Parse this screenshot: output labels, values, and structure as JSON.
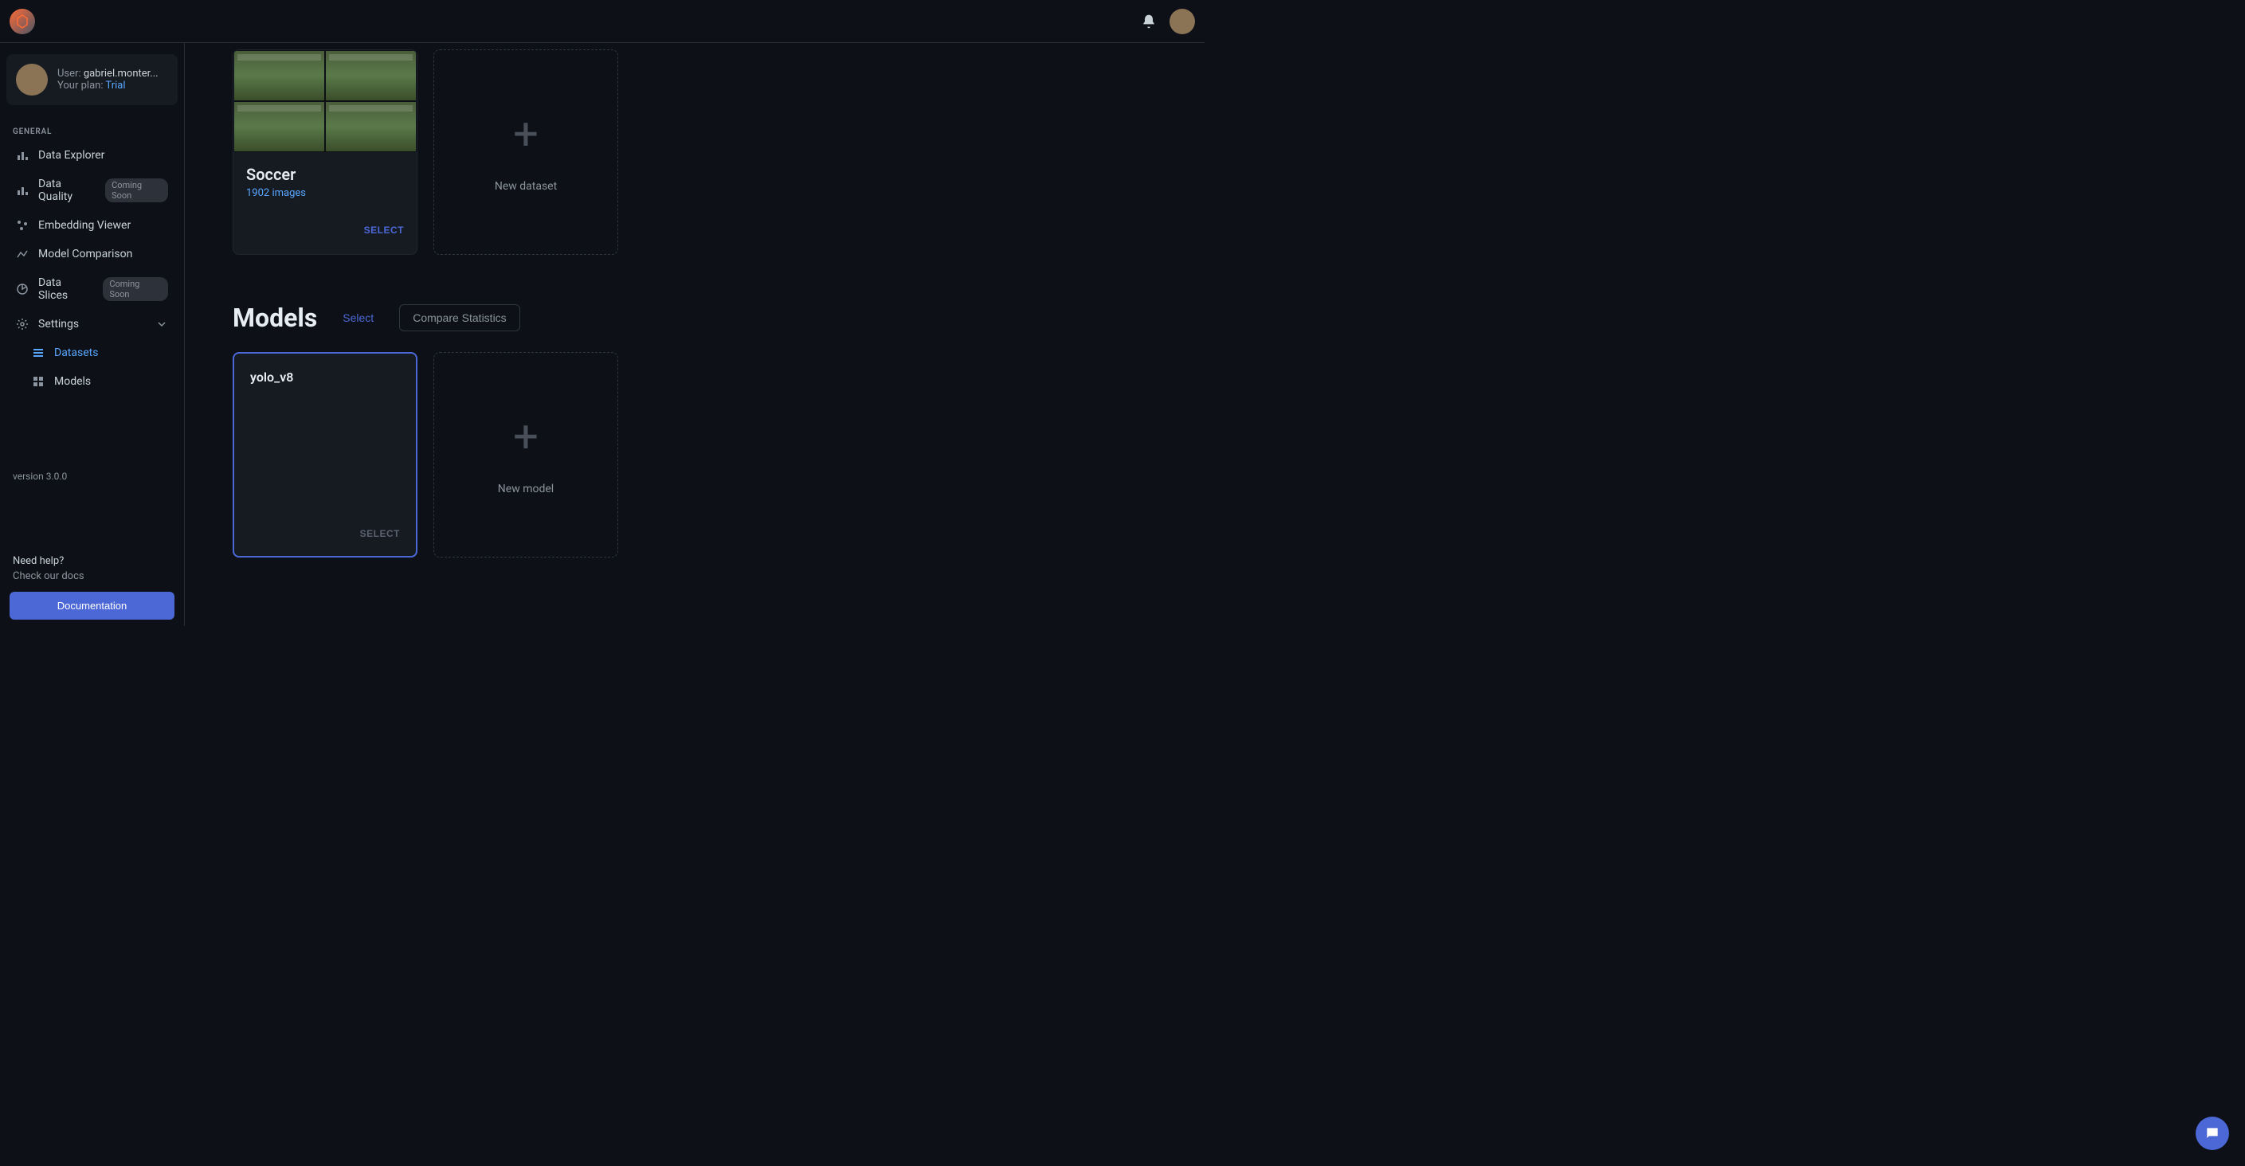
{
  "user": {
    "label": "User: ",
    "name": "gabriel.monter...",
    "plan_label": "Your plan: ",
    "plan": "Trial"
  },
  "sidebar": {
    "section": "GENERAL",
    "items": [
      {
        "label": "Data Explorer"
      },
      {
        "label": "Data Quality",
        "badge": "Coming Soon"
      },
      {
        "label": "Embedding Viewer"
      },
      {
        "label": "Model Comparison"
      },
      {
        "label": "Data Slices",
        "badge": "Coming Soon"
      },
      {
        "label": "Settings"
      }
    ],
    "sub_items": [
      {
        "label": "Datasets"
      },
      {
        "label": "Models"
      }
    ],
    "version": "version 3.0.0",
    "help_title": "Need help?",
    "help_sub": "Check our docs",
    "doc_btn": "Documentation"
  },
  "datasets": {
    "card": {
      "title": "Soccer",
      "meta": "1902 images",
      "select": "SELECT"
    },
    "new_label": "New dataset"
  },
  "models": {
    "title": "Models",
    "select_btn": "Select",
    "compare_btn": "Compare Statistics",
    "card": {
      "title": "yolo_v8",
      "select": "SELECT"
    },
    "new_label": "New model"
  }
}
